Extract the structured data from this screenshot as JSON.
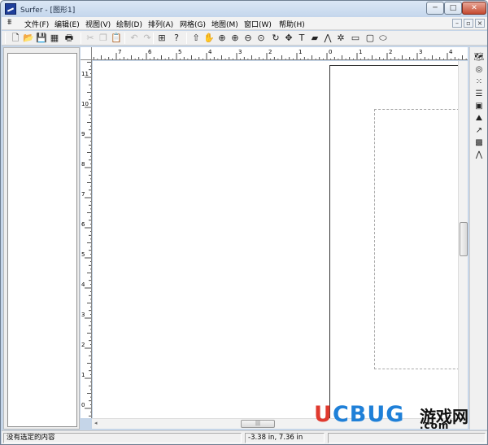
{
  "window": {
    "title": "Surfer - [图形1]"
  },
  "titlebar_buttons": {
    "minimize": "─",
    "maximize": "□",
    "close": "✕"
  },
  "menu": {
    "items": [
      "文件(F)",
      "编辑(E)",
      "视图(V)",
      "绘制(D)",
      "排列(A)",
      "网格(G)",
      "地图(M)",
      "窗口(W)",
      "帮助(H)"
    ],
    "mdi_controls": [
      "–",
      "▫",
      "×"
    ]
  },
  "toolbar": {
    "tools": [
      {
        "name": "new-document-icon",
        "glyph": "🗋",
        "enabled": true
      },
      {
        "name": "open-folder-icon",
        "glyph": "📂",
        "enabled": true
      },
      {
        "name": "save-disk-icon",
        "glyph": "💾",
        "enabled": true
      },
      {
        "name": "worksheet-icon",
        "glyph": "▦",
        "enabled": true
      },
      {
        "name": "print-icon",
        "glyph": "🖶",
        "enabled": true
      },
      {
        "name": "cut-icon",
        "glyph": "✂",
        "enabled": false
      },
      {
        "name": "copy-icon",
        "glyph": "❐",
        "enabled": false
      },
      {
        "name": "paste-icon",
        "glyph": "📋",
        "enabled": true
      },
      {
        "name": "undo-icon",
        "glyph": "↶",
        "enabled": false
      },
      {
        "name": "redo-icon",
        "glyph": "↷",
        "enabled": false
      },
      {
        "name": "object-manager-icon",
        "glyph": "⊞",
        "enabled": true
      },
      {
        "name": "context-help-icon",
        "glyph": "?",
        "enabled": true
      },
      {
        "name": "select-arrow-icon",
        "glyph": "⇧",
        "enabled": true
      },
      {
        "name": "pan-hand-icon",
        "glyph": "✋",
        "enabled": true
      },
      {
        "name": "zoom-rect-icon",
        "glyph": "⊕",
        "enabled": true
      },
      {
        "name": "zoom-in-icon",
        "glyph": "⊕",
        "enabled": true
      },
      {
        "name": "zoom-out-icon",
        "glyph": "⊖",
        "enabled": true
      },
      {
        "name": "zoom-page-icon",
        "glyph": "⊙",
        "enabled": true
      },
      {
        "name": "rotate-icon",
        "glyph": "↻",
        "enabled": true
      },
      {
        "name": "reshape-icon",
        "glyph": "✥",
        "enabled": true
      },
      {
        "name": "text-tool-icon",
        "glyph": "T",
        "enabled": true
      },
      {
        "name": "polygon-tool-icon",
        "glyph": "▰",
        "enabled": true
      },
      {
        "name": "polyline-tool-icon",
        "glyph": "⋀",
        "enabled": true
      },
      {
        "name": "symbol-tool-icon",
        "glyph": "✲",
        "enabled": true
      },
      {
        "name": "rectangle-tool-icon",
        "glyph": "▭",
        "enabled": true
      },
      {
        "name": "rounded-rect-tool-icon",
        "glyph": "▢",
        "enabled": true
      },
      {
        "name": "ellipse-tool-icon",
        "glyph": "⬭",
        "enabled": true
      }
    ]
  },
  "rulers": {
    "horizontal_labels": [
      "7",
      "6",
      "5",
      "4",
      "3",
      "2",
      "1",
      "0",
      "1",
      "2",
      "3",
      "4"
    ],
    "vertical_labels": [
      "11",
      "10",
      "9",
      "8",
      "7",
      "6",
      "5",
      "4",
      "3",
      "2",
      "1",
      "0"
    ]
  },
  "right_toolbar": {
    "tools": [
      {
        "name": "base-map-icon",
        "glyph": "🗺"
      },
      {
        "name": "contour-map-icon",
        "glyph": "◎"
      },
      {
        "name": "post-map-icon",
        "glyph": "⁙"
      },
      {
        "name": "classed-post-map-icon",
        "glyph": "☰"
      },
      {
        "name": "image-map-icon",
        "glyph": "▣"
      },
      {
        "name": "shaded-relief-map-icon",
        "glyph": "⛰"
      },
      {
        "name": "vector-map-icon",
        "glyph": "↗"
      },
      {
        "name": "wireframe-icon",
        "glyph": "▩"
      },
      {
        "name": "surface-icon",
        "glyph": "⋀"
      }
    ]
  },
  "statusbar": {
    "message": "没有选定的内容",
    "coordinates": "-3.38 in, 7.36 in"
  },
  "watermark": {
    "brand_first": "U",
    "brand_rest": "CBUG",
    "chinese": "游戏网",
    "suffix": ".com"
  },
  "colors": {
    "watermark_red": "#e03a2f",
    "watermark_blue": "#1f80d8"
  }
}
